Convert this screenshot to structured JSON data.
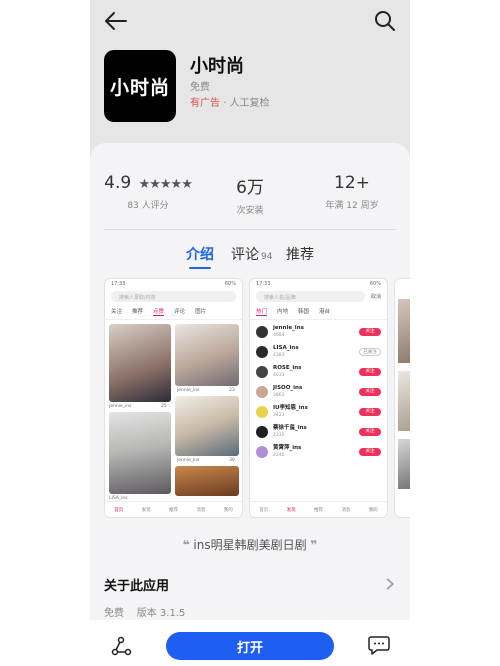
{
  "app": {
    "logo_text": "小时尚",
    "name": "小时尚",
    "price": "免费",
    "ad_tag": "有广告",
    "review_tag": "人工复检",
    "tag_sep": "·"
  },
  "stats": {
    "rating": "4.9",
    "rating_count": "83 人评分",
    "installs": "6万",
    "installs_label": "次安装",
    "age": "12+",
    "age_label": "年满 12 周岁"
  },
  "tabs": {
    "intro": "介绍",
    "reviews": "评论",
    "reviews_count": "94",
    "recommend": "推荐"
  },
  "shot1": {
    "time": "17:33",
    "battery": "60%",
    "search_placeholder": "搜索人录取/内容",
    "tabs": [
      "关注",
      "推荐",
      "点赞",
      "评论",
      "图片"
    ],
    "nav": [
      "首页",
      "发现",
      "推荐",
      "消息",
      "我的"
    ],
    "cards": [
      {
        "user": "jennie_ins",
        "likes": "25"
      },
      {
        "user": "jennie_ins",
        "likes": "23"
      },
      {
        "user": "jennie_ins",
        "likes": "30"
      },
      {
        "user": "LISA_ins",
        "likes": ""
      }
    ]
  },
  "shot2": {
    "time": "17:33",
    "battery": "60%",
    "search_placeholder": "搜索人名/品牌",
    "cancel": "取消",
    "tabs": [
      "热门",
      "内地",
      "韩国",
      "港台"
    ],
    "nav": [
      "首页",
      "发现",
      "推荐",
      "消息",
      "我的"
    ],
    "follow_label": "关注",
    "followed_label": "已关注",
    "users": [
      {
        "name": "jennie_ins",
        "count": "4684",
        "followed": false
      },
      {
        "name": "LISA_ins",
        "count": "4383",
        "followed": true
      },
      {
        "name": "ROSE_ins",
        "count": "4033",
        "followed": false
      },
      {
        "name": "JISOO_ins",
        "count": "3863",
        "followed": false
      },
      {
        "name": "IU李知恩_ins",
        "count": "3423",
        "followed": false
      },
      {
        "name": "蔡徐千玺_ins",
        "count": "2335",
        "followed": false
      },
      {
        "name": "黄霄萍_ins",
        "count": "2240",
        "followed": false
      }
    ]
  },
  "quote": {
    "open": "❝",
    "text": "ins明星韩剧美剧日剧",
    "close": "❞"
  },
  "about": {
    "title": "关于此应用",
    "price": "免费",
    "version": "版本 3.1.5"
  },
  "bottom": {
    "open_label": "打开"
  },
  "colors": {
    "accent": "#1e5ef0",
    "tab_active": "#1e63e8",
    "ad_red": "#d9534f",
    "pink": "#f0305a"
  }
}
